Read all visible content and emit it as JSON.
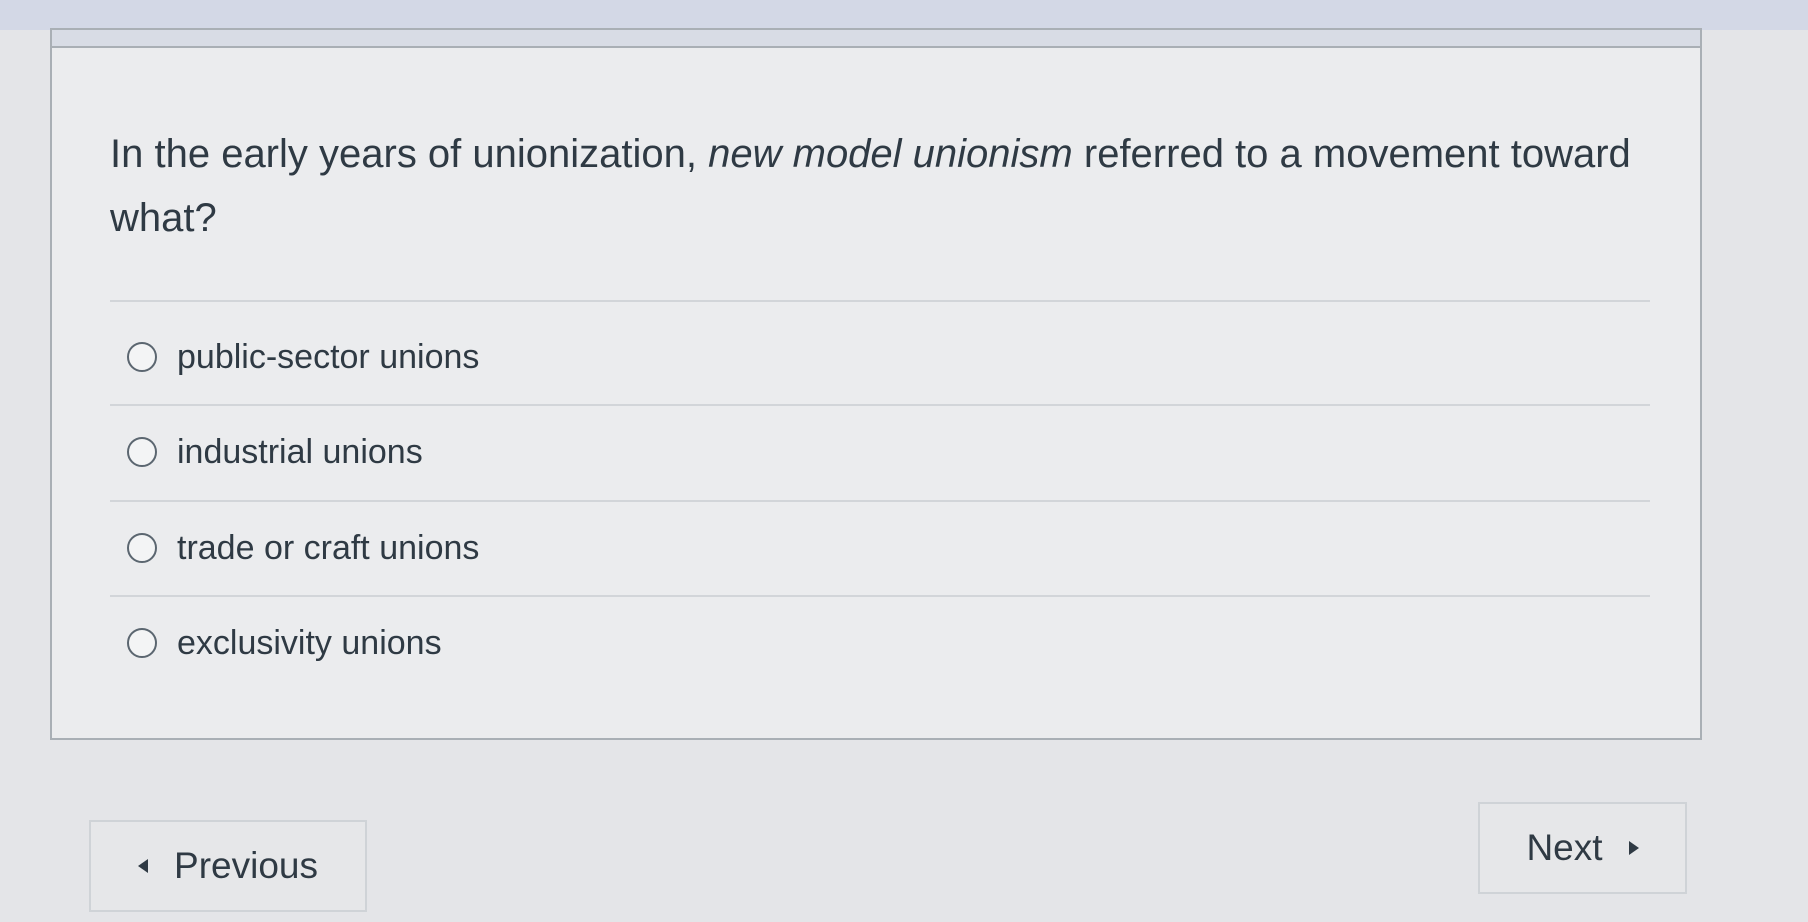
{
  "question": {
    "text_before": "In the early years of unionization, ",
    "text_italic": "new model unionism",
    "text_after": " referred to a movement toward what?"
  },
  "answers": [
    {
      "label": "public-sector unions",
      "selected": false
    },
    {
      "label": "industrial unions",
      "selected": false
    },
    {
      "label": "trade or craft unions",
      "selected": false
    },
    {
      "label": "exclusivity unions",
      "selected": false
    }
  ],
  "navigation": {
    "previous_label": "Previous",
    "next_label": "Next"
  },
  "icons": {
    "previous": "triangle-left-icon",
    "next": "triangle-right-icon"
  }
}
